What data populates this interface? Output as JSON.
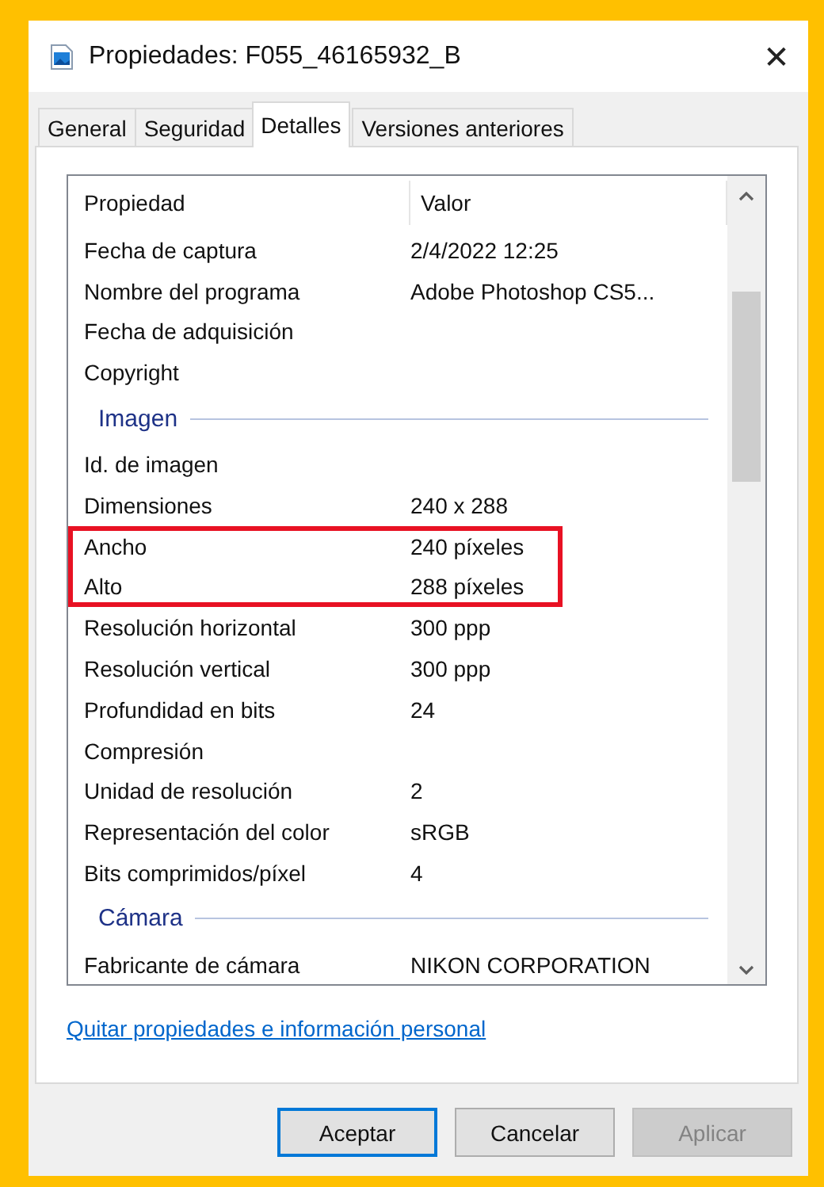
{
  "window": {
    "title": "Propiedades: F055_46165932_B",
    "close": "✕"
  },
  "tabs": [
    {
      "label": "General",
      "selected": false
    },
    {
      "label": "Seguridad",
      "selected": false
    },
    {
      "label": "Detalles",
      "selected": true
    },
    {
      "label": "Versiones anteriores",
      "selected": false
    }
  ],
  "table": {
    "columns": [
      "Propiedad",
      "Valor"
    ],
    "rows": [
      {
        "kind": "row",
        "name": "Fecha de captura",
        "value": "2/4/2022 12:25",
        "highlighted": false
      },
      {
        "kind": "row",
        "name": "Nombre del programa",
        "value": "Adobe Photoshop CS5...",
        "highlighted": false
      },
      {
        "kind": "row",
        "name": "Fecha de adquisición",
        "highlighted": false
      },
      {
        "kind": "row",
        "name": "Copyright",
        "highlighted": false
      },
      {
        "kind": "group",
        "name": "Imagen"
      },
      {
        "kind": "row",
        "name": "Id. de imagen",
        "highlighted": false
      },
      {
        "kind": "row",
        "name": "Dimensiones",
        "value": "240 x 288",
        "highlighted": false
      },
      {
        "kind": "row",
        "name": "Ancho",
        "value": "240 píxeles",
        "highlighted": true
      },
      {
        "kind": "row",
        "name": "Alto",
        "value": "288 píxeles",
        "highlighted": true
      },
      {
        "kind": "row",
        "name": "Resolución horizontal",
        "value": "300 ppp",
        "highlighted": false
      },
      {
        "kind": "row",
        "name": "Resolución vertical",
        "value": "300 ppp",
        "highlighted": false
      },
      {
        "kind": "row",
        "name": "Profundidad en bits",
        "value": "24",
        "highlighted": false
      },
      {
        "kind": "row",
        "name": "Compresión",
        "highlighted": false
      },
      {
        "kind": "row",
        "name": "Unidad de resolución",
        "value": "2",
        "highlighted": false
      },
      {
        "kind": "row",
        "name": "Representación del color",
        "value": "sRGB",
        "highlighted": false
      },
      {
        "kind": "row",
        "name": "Bits comprimidos/píxel",
        "value": "4",
        "highlighted": false
      },
      {
        "kind": "group",
        "name": "Cámara"
      },
      {
        "kind": "row",
        "name": "Fabricante de cámara",
        "value": "NIKON CORPORATION",
        "highlighted": false
      }
    ]
  },
  "link": "Quitar propiedades e información personal",
  "buttons": [
    {
      "label": "Aceptar",
      "default": true,
      "disabled": false
    },
    {
      "label": "Cancelar",
      "default": false,
      "disabled": false
    },
    {
      "label": "Aplicar",
      "default": false,
      "disabled": true
    }
  ]
}
